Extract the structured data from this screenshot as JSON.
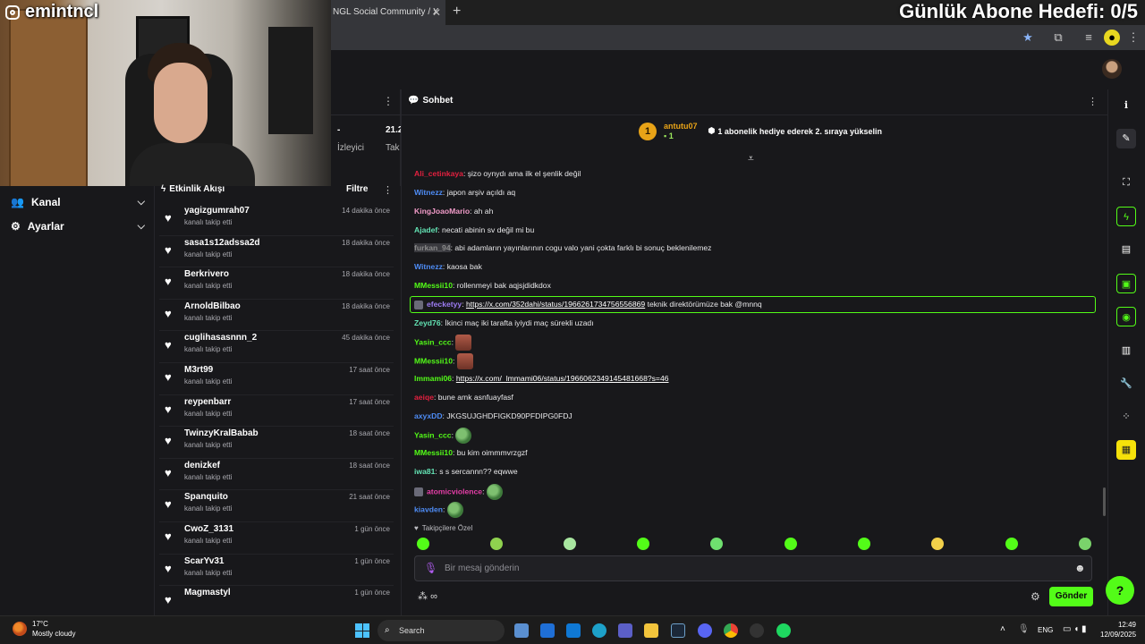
{
  "webcam": {
    "streamer_name": "emintncl"
  },
  "browser": {
    "tab_title": "NGL Social Community / X",
    "tab_close": "✕",
    "new_tab": "+"
  },
  "overlay": {
    "goal_text": "Günlük Abone Hedefi: 0/5"
  },
  "left_nav": {
    "items": [
      {
        "label": "Kanal",
        "icon": "users-icon"
      },
      {
        "label": "Ayarlar",
        "icon": "gear-icon"
      }
    ]
  },
  "stats": {
    "dash": "-",
    "value": "21.2",
    "label1": "İzleyici",
    "label2": "Tak"
  },
  "feed": {
    "title": "Etkinlik Akışı",
    "filter_label": "Filtre",
    "rows": [
      {
        "user": "yagizgumrah07",
        "action": "kanalı takip etti",
        "time": "14 dakika önce"
      },
      {
        "user": "sasa1s12adssa2d",
        "action": "kanalı takip etti",
        "time": "18 dakika önce"
      },
      {
        "user": "Berkrivero",
        "action": "kanalı takip etti",
        "time": "18 dakika önce"
      },
      {
        "user": "ArnoldBilbao",
        "action": "kanalı takip etti",
        "time": "18 dakika önce"
      },
      {
        "user": "cuglihasasnnn_2",
        "action": "kanalı takip etti",
        "time": "45 dakika önce"
      },
      {
        "user": "M3rt99",
        "action": "kanalı takip etti",
        "time": "17 saat önce"
      },
      {
        "user": "reypenbarr",
        "action": "kanalı takip etti",
        "time": "17 saat önce"
      },
      {
        "user": "TwinzyKralBabab",
        "action": "kanalı takip etti",
        "time": "18 saat önce"
      },
      {
        "user": "denizkef",
        "action": "kanalı takip etti",
        "time": "18 saat önce"
      },
      {
        "user": "Spanquito",
        "action": "kanalı takip etti",
        "time": "21 saat önce"
      },
      {
        "user": "CwoZ_3131",
        "action": "kanalı takip etti",
        "time": "1 gün önce"
      },
      {
        "user": "ScarYv31",
        "action": "kanalı takip etti",
        "time": "1 gün önce"
      },
      {
        "user": "Magmastyl",
        "action": "",
        "time": "1 gün önce"
      }
    ]
  },
  "chat": {
    "title": "Sohbet",
    "pinned": {
      "rank": "1",
      "user": "antutu07",
      "count": "1",
      "message": "1 abonelik hediye ederek 2. sıraya yükselin"
    },
    "messages": [
      {
        "user": "Ali_cetinkaya",
        "color": "#e2203f",
        "text": "şizo oynydı ama ilk el şenlik değil"
      },
      {
        "user": "Witnezz",
        "color": "#4e8cf5",
        "text": "japon arşiv açıldı aq"
      },
      {
        "user": "KingJoaoMario",
        "color": "#f19bc8",
        "text": "ah ah"
      },
      {
        "user": "Ajadef",
        "color": "#63e3b4",
        "text": "necati abinin sv değil mi bu"
      },
      {
        "user": "furkan_94",
        "color": "#8a8a8a",
        "text": "abi adamların yayınlarının cogu valo yani çokta farklı bi sonuç beklenilemez"
      },
      {
        "user": "Witnezz",
        "color": "#4e8cf5",
        "text": "kaosa bak"
      },
      {
        "user": "MMessii10",
        "color": "#53fc18",
        "text": "rollenmeyi bak aqjsjdidkdox"
      },
      {
        "user": "efecketyy",
        "color": "#9d7cf2",
        "link": "https://x.com/352dahi/status/1966261734756556869",
        "text": "teknik direktörümüze bak @mnnq"
      },
      {
        "user": "Zeyd76",
        "color": "#63e3b4",
        "text": "İkinci maç iki tarafta iyiydi maç sürekli uzadı"
      },
      {
        "user": "Yasin_ccc",
        "color": "#53fc18",
        "text": ""
      },
      {
        "user": "MMessii10",
        "color": "#53fc18",
        "text": ""
      },
      {
        "user": "lmmami06",
        "color": "#53fc18",
        "link": "https://x.com/_lmmami06/status/1966062349145481668?s=46",
        "text": ""
      },
      {
        "user": "aeiqe",
        "color": "#e2203f",
        "text": "bune amk asnfuayfasf"
      },
      {
        "user": "axyxDD",
        "color": "#4e8cf5",
        "text": "JKGSUJGHDFIGKD90PFDIPG0FDJ"
      },
      {
        "user": "Yasin_ccc",
        "color": "#53fc18",
        "text": ""
      },
      {
        "user": "MMessii10",
        "color": "#53fc18",
        "text": "bu kim oimmmvrzgzf"
      },
      {
        "user": "iwa81",
        "color": "#63e3b4",
        "text": "s s sercannn?? eqwwe"
      },
      {
        "user": "atomicviolence",
        "color": "#e63ea8",
        "text": ""
      },
      {
        "user": "kiavden",
        "color": "#4e8cf5",
        "text": ""
      }
    ],
    "followers_only": "Takipçilere Özel",
    "input_placeholder": "Bir mesaj gönderin",
    "send_label": "Gönder"
  },
  "taskbar": {
    "temp": "17°C",
    "weather": "Mostly cloudy",
    "search": "Search",
    "lang": "ENG",
    "time": "12:49",
    "date": "12/09/2025"
  },
  "colors": {
    "accent": "#53fc18",
    "bg": "#18181b",
    "goal_yellow": "#e8a317"
  }
}
